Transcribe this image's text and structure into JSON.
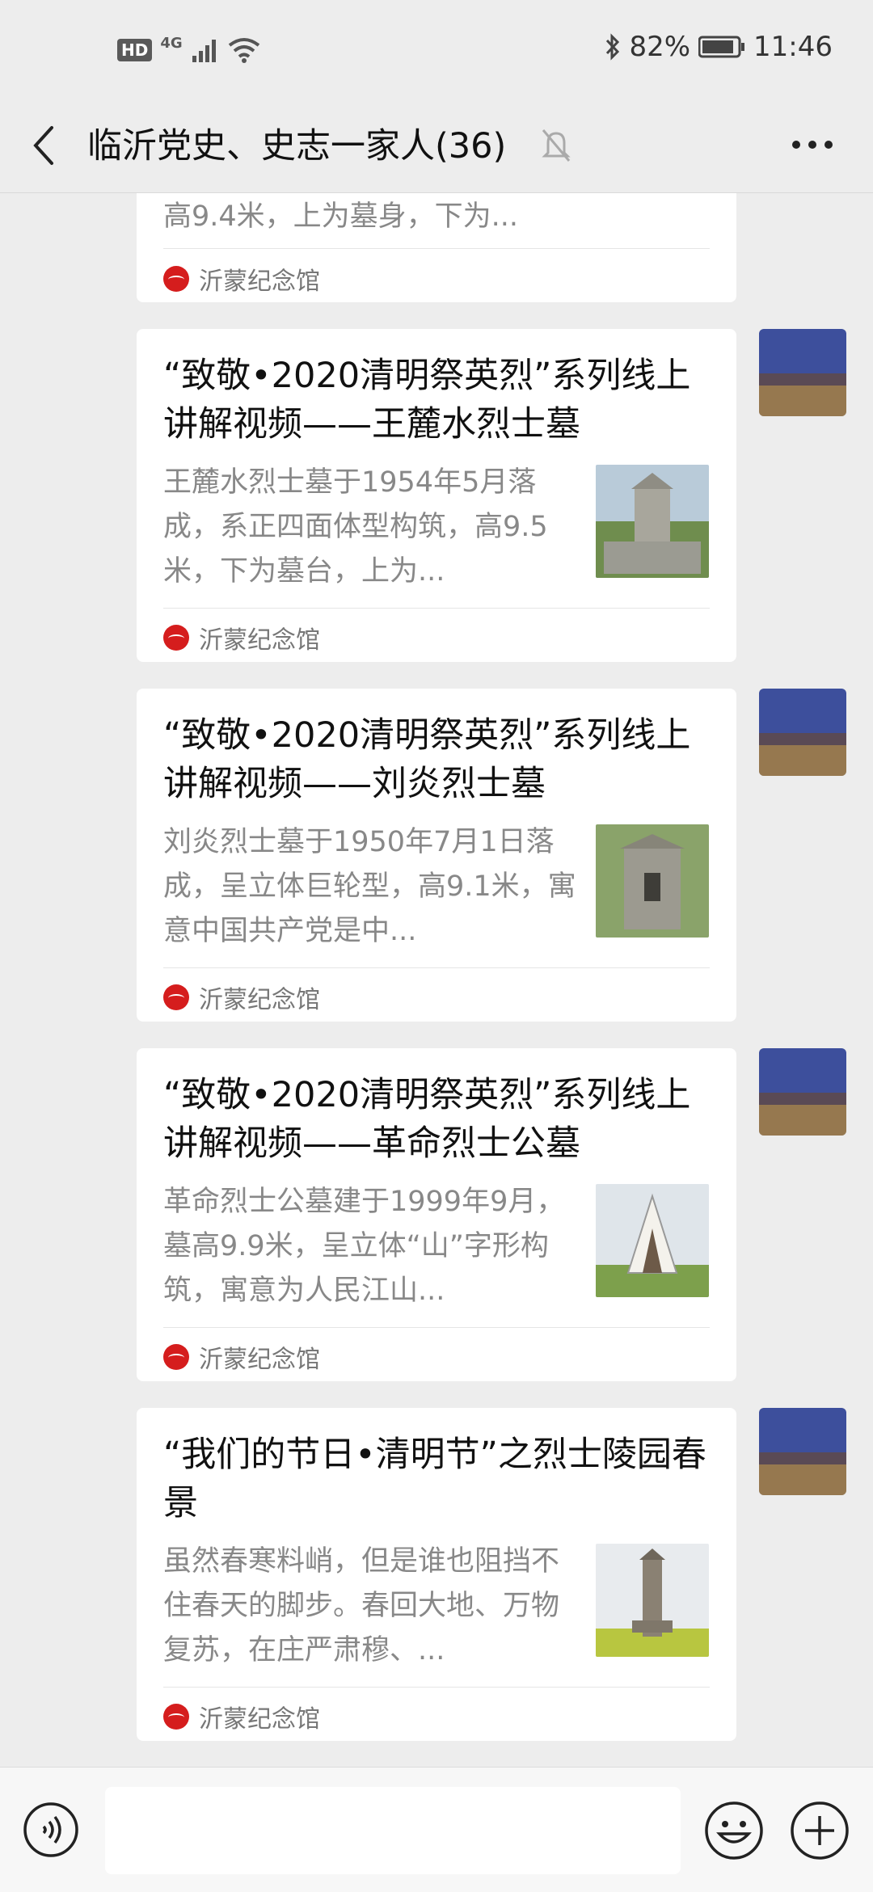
{
  "status_bar": {
    "hd_label": "HD",
    "network_label": "4G",
    "battery_percent": "82%",
    "time": "11:46"
  },
  "nav": {
    "title": "临沂党史、史志一家人(36)"
  },
  "messages": [
    {
      "title": "",
      "desc": "高9.4米，上为墓身，下为...",
      "source": "沂蒙纪念馆"
    },
    {
      "title": "“致敬•2020清明祭英烈”系列线上讲解视频——王麓水烈士墓",
      "desc": "王麓水烈士墓于1954年5月落成，系正四面体型构筑，高9.5米，下为墓台，上为...",
      "source": "沂蒙纪念馆"
    },
    {
      "title": "“致敬•2020清明祭英烈”系列线上讲解视频——刘炎烈士墓",
      "desc": "刘炎烈士墓于1950年7月1日落成，呈立体巨轮型，高9.1米，寓意中国共产党是中...",
      "source": "沂蒙纪念馆"
    },
    {
      "title": "“致敬•2020清明祭英烈”系列线上讲解视频——革命烈士公墓",
      "desc": "革命烈士公墓建于1999年9月，墓高9.9米，呈立体“山”字形构筑，寓意为人民江山...",
      "source": "沂蒙纪念馆"
    },
    {
      "title": "“我们的节日•清明节”之烈士陵园春景",
      "desc": "虽然春寒料峭，但是谁也阻挡不住春天的脚步。春回大地、万物复苏，在庄严肃穆、...",
      "source": "沂蒙纪念馆"
    }
  ],
  "icons": {
    "back": "chevron-left-icon",
    "mute": "bell-off-icon",
    "more": "more-icon",
    "voice": "voice-icon",
    "emoji": "emoji-icon",
    "plus": "plus-icon"
  },
  "colors": {
    "background": "#ededed",
    "card": "#ffffff",
    "source_icon": "#d51d1d"
  }
}
